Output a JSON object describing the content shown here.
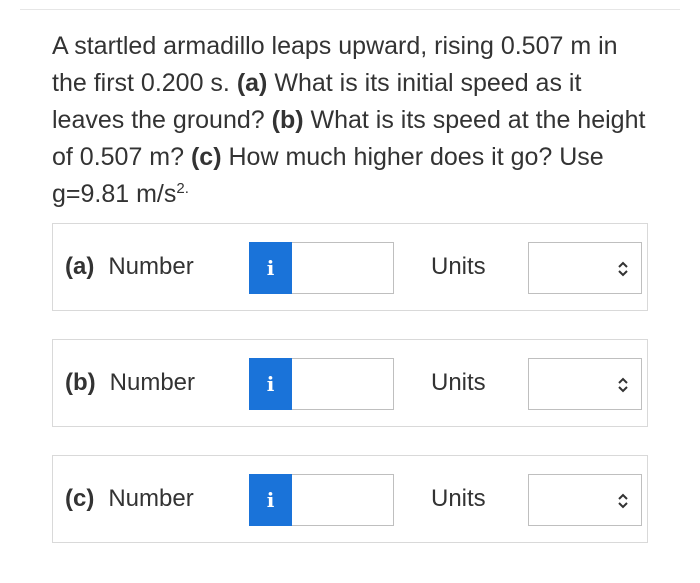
{
  "question": {
    "sentence1": "A startled armadillo leaps upward, rising 0.507 m in the first 0.200 s.",
    "part_a_marker": "(a)",
    "part_a_text": "What is its initial speed as it leaves the ground?",
    "part_b_marker": "(b)",
    "part_b_text": "What is its speed at the height of 0.507 m?",
    "part_c_marker": "(c)",
    "part_c_text": "How much higher does it go? Use g=9.81 m/s",
    "exponent": "2."
  },
  "parts": [
    {
      "letter": "(a)",
      "number_label": "Number",
      "info_label": "i",
      "number_value": "",
      "units_label": "Units",
      "units_value": ""
    },
    {
      "letter": "(b)",
      "number_label": "Number",
      "info_label": "i",
      "number_value": "",
      "units_label": "Units",
      "units_value": ""
    },
    {
      "letter": "(c)",
      "number_label": "Number",
      "info_label": "i",
      "number_value": "",
      "units_label": "Units",
      "units_value": ""
    }
  ],
  "colors": {
    "info_button": "#1a73d9",
    "text": "#333333",
    "border": "#d9d9d9"
  },
  "icons": {
    "info": "info-icon",
    "select": "chevron-up-down-icon"
  }
}
